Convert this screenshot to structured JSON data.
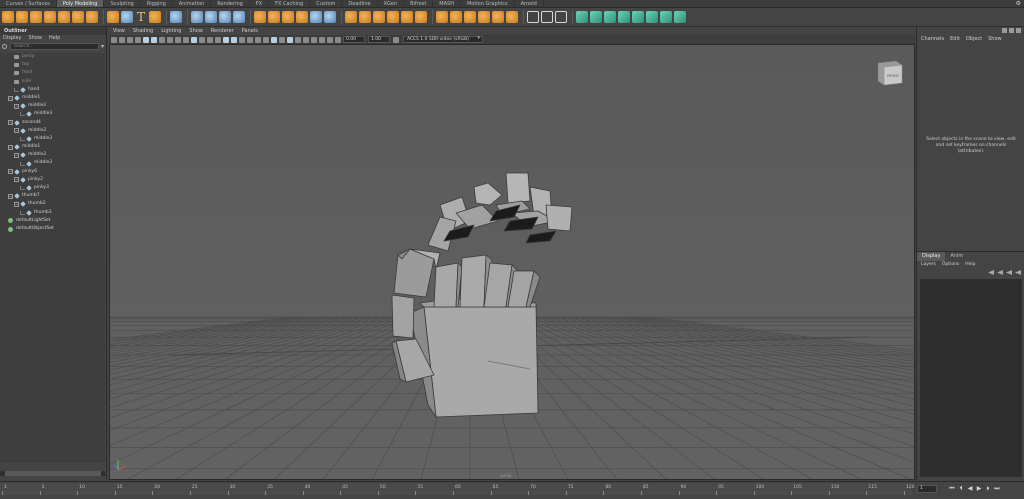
{
  "shelf": {
    "tabs": [
      {
        "label": "Curves / Surfaces",
        "active": false
      },
      {
        "label": "Poly Modeling",
        "active": true
      },
      {
        "label": "Sculpting",
        "active": false
      },
      {
        "label": "Rigging",
        "active": false
      },
      {
        "label": "Animation",
        "active": false
      },
      {
        "label": "Rendering",
        "active": false
      },
      {
        "label": "FX",
        "active": false
      },
      {
        "label": "FX Caching",
        "active": false
      },
      {
        "label": "Custom",
        "active": false
      },
      {
        "label": "Deadline",
        "active": false
      },
      {
        "label": "XGen",
        "active": false
      },
      {
        "label": "Bifrost",
        "active": false
      },
      {
        "label": "MASH",
        "active": false
      },
      {
        "label": "Motion Graphics",
        "active": false
      },
      {
        "label": "Arnold",
        "active": false
      }
    ],
    "gear_icon": "⚙"
  },
  "outliner": {
    "title": "Outliner",
    "menu": [
      "Display",
      "Show",
      "Help"
    ],
    "search_placeholder": "Search...",
    "items": [
      {
        "label": "persp",
        "icon": "camera",
        "indent": 2,
        "dim": true
      },
      {
        "label": "top",
        "icon": "camera",
        "indent": 2,
        "dim": true
      },
      {
        "label": "front",
        "icon": "camera",
        "indent": 2,
        "dim": true
      },
      {
        "label": "side",
        "icon": "camera",
        "indent": 2,
        "dim": true
      },
      {
        "label": "hand",
        "icon": "mesh",
        "indent": 2,
        "dim": false
      },
      {
        "label": "middle1",
        "icon": "mesh",
        "indent": 1,
        "expand": "−",
        "dim": false
      },
      {
        "label": "middle2",
        "icon": "mesh",
        "indent": 2,
        "expand": "−",
        "dim": false
      },
      {
        "label": "middle3",
        "icon": "mesh",
        "indent": 3,
        "dim": false
      },
      {
        "label": "second4",
        "icon": "mesh",
        "indent": 1,
        "expand": "−",
        "dim": false
      },
      {
        "label": "middle2",
        "icon": "mesh",
        "indent": 2,
        "expand": "−",
        "dim": false
      },
      {
        "label": "middle3",
        "icon": "mesh",
        "indent": 3,
        "dim": false
      },
      {
        "label": "middle1",
        "icon": "mesh",
        "indent": 1,
        "expand": "−",
        "dim": false
      },
      {
        "label": "middle2",
        "icon": "mesh",
        "indent": 2,
        "expand": "−",
        "dim": false
      },
      {
        "label": "middle3",
        "icon": "mesh",
        "indent": 3,
        "dim": false
      },
      {
        "label": "pinky6",
        "icon": "mesh",
        "indent": 1,
        "expand": "−",
        "dim": false
      },
      {
        "label": "pinky2",
        "icon": "mesh",
        "indent": 2,
        "expand": "−",
        "dim": false
      },
      {
        "label": "pinky3",
        "icon": "mesh",
        "indent": 3,
        "dim": false
      },
      {
        "label": "thumb7",
        "icon": "mesh",
        "indent": 1,
        "expand": "−",
        "dim": false
      },
      {
        "label": "thumb2",
        "icon": "mesh",
        "indent": 2,
        "expand": "−",
        "dim": false
      },
      {
        "label": "thumb3",
        "icon": "mesh",
        "indent": 3,
        "dim": false
      },
      {
        "label": "defaultLightSet",
        "icon": "set",
        "indent": 1,
        "dim": false
      },
      {
        "label": "defaultObjectSet",
        "icon": "set",
        "indent": 1,
        "dim": false
      }
    ]
  },
  "viewport": {
    "menu": [
      "View",
      "Shading",
      "Lighting",
      "Show",
      "Renderer",
      "Panels"
    ],
    "exposure": "0.00",
    "gamma": "1.00",
    "color_space": "ACES 1.0 SDR-video (sRGB)",
    "viewcube_label": "FRONT",
    "camera_label": "persp"
  },
  "channel_box": {
    "menu": [
      "Channels",
      "Edit",
      "Object",
      "Show"
    ],
    "message": "Select objects in the scene to view, edit and set keyframes on channels (attributes)."
  },
  "layer_editor": {
    "tabs": [
      {
        "label": "Display",
        "active": true
      },
      {
        "label": "Anim",
        "active": false
      }
    ],
    "menu": [
      "Layers",
      "Options",
      "Help"
    ]
  },
  "time_slider": {
    "ticks": [
      "1",
      "5",
      "10",
      "15",
      "20",
      "25",
      "30",
      "35",
      "40",
      "45",
      "50",
      "55",
      "60",
      "65",
      "70",
      "75",
      "80",
      "85",
      "90",
      "95",
      "100",
      "105",
      "110",
      "115",
      "120"
    ],
    "current_frame": "1",
    "playback_icons": [
      "⏮",
      "⏴",
      "◀",
      "▶",
      "⏵",
      "⏭"
    ]
  },
  "colors": {
    "viewport_bg": "#5d5d5d",
    "ui_bg": "#444444",
    "active_tab": "#5c5c5c",
    "accent_orange": "#e39b3a",
    "accent_green": "#4fb89e"
  }
}
